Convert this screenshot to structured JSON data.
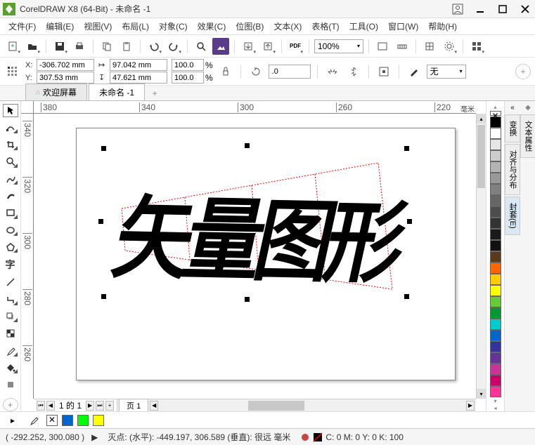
{
  "title": "CorelDRAW X8 (64-Bit) - 未命名 -1",
  "app_icon_letter": "",
  "menus": [
    "文件(F)",
    "编辑(E)",
    "视图(V)",
    "布局(L)",
    "对象(C)",
    "效果(C)",
    "位图(B)",
    "文本(X)",
    "表格(T)",
    "工具(O)",
    "窗口(W)",
    "帮助(H)"
  ],
  "zoom": "100%",
  "props": {
    "x": "-306.702 mm",
    "y": "307.53 mm",
    "w": "97.042 mm",
    "h": "47.621 mm",
    "sx": "100.0",
    "sy": "100.0",
    "pct_unit": "%",
    "rotation": ".0",
    "outline": "无"
  },
  "tabs": {
    "welcome": "欢迎屏幕",
    "doc": "未命名 -1"
  },
  "ruler_h": [
    "380",
    "340",
    "300",
    "260",
    "220"
  ],
  "ruler_unit": "毫米",
  "ruler_v": [
    "340",
    "320",
    "300",
    "280",
    "260"
  ],
  "canvas_text": "矢量图形",
  "pager": {
    "label": "1 的 1",
    "page_tab": "页 1"
  },
  "palette": [
    "#000000",
    "#ffffff",
    "#e6e6e6",
    "#cccccc",
    "#b3b3b3",
    "#999999",
    "#808080",
    "#666666",
    "#4d4d4d",
    "#333333",
    "#1a1a1a",
    "#111111",
    "#5b3a1a",
    "#ff6600",
    "#ffcc00",
    "#ffff00",
    "#66cc33",
    "#009933",
    "#00cccc",
    "#0066cc",
    "#333399",
    "#663399",
    "#cc3399",
    "#cc0066",
    "#ff3399"
  ],
  "dockers": {
    "col1": [
      "变换",
      "对齐与分布",
      "封套(E)"
    ],
    "col2": [
      "文本属性"
    ]
  },
  "quick_swatches": [
    "#0066cc",
    "#00ff00",
    "#ffff00"
  ],
  "status": {
    "cursor": "( -292.252, 300.080 )",
    "anchor": "灭点: (水平): -449.197, 306.589   (垂直): 很远  毫米",
    "color": "C: 0 M: 0 Y: 0 K: 100"
  }
}
